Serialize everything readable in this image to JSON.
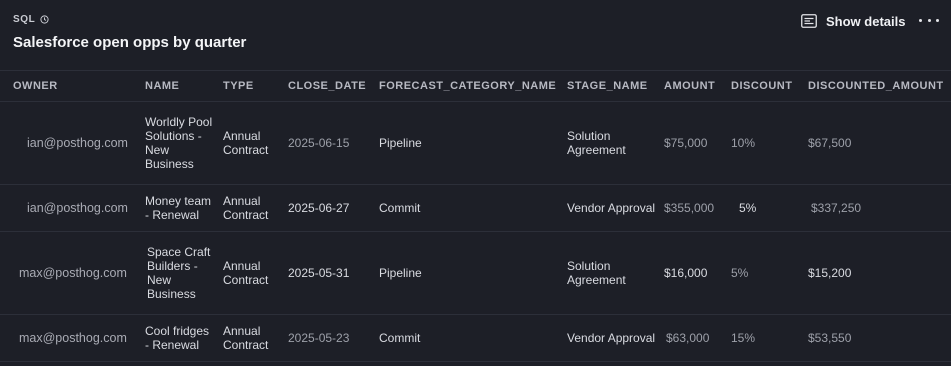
{
  "header": {
    "kind_label": "SQL",
    "title": "Salesforce open opps by quarter",
    "show_details_label": "Show details",
    "icons": {
      "kind": "clock-icon",
      "details": "details-panel-icon",
      "more": "more-dots-icon"
    }
  },
  "table": {
    "columns": [
      "OWNER",
      "NAME",
      "TYPE",
      "CLOSE_DATE",
      "FORECAST_CATEGORY_NAME",
      "STAGE_NAME",
      "AMOUNT",
      "DISCOUNT",
      "DISCOUNTED_AMOUNT"
    ],
    "rows": [
      {
        "owner": "ian@posthog.com",
        "name": "Worldly Pool Solutions - New Business",
        "type": "Annual Contract",
        "close_date": "2025-06-15",
        "forecast_category": "Pipeline",
        "stage": "Solution Agreement",
        "amount": "$75,000",
        "discount": "10%",
        "discounted_amount": "$67,500"
      },
      {
        "owner": "ian@posthog.com",
        "name": "Money team - Renewal",
        "type": "Annual Contract",
        "close_date": "2025-06-27",
        "forecast_category": "Commit",
        "stage": "Vendor Approval",
        "amount": "$355,000",
        "discount": "5%",
        "discounted_amount": "$337,250"
      },
      {
        "owner": "max@posthog.com",
        "name": "Space Craft Builders - New Business",
        "type": "Annual Contract",
        "close_date": "2025-05-31",
        "forecast_category": "Pipeline",
        "stage": "Solution Agreement",
        "amount": "$16,000",
        "discount": "5%",
        "discounted_amount": "$15,200"
      },
      {
        "owner": "max@posthog.com",
        "name": "Cool fridges - Renewal",
        "type": "Annual Contract",
        "close_date": "2025-05-23",
        "forecast_category": "Commit",
        "stage": "Vendor Approval",
        "amount": "$63,000",
        "discount": "15%",
        "discounted_amount": "$53,550"
      }
    ]
  },
  "colors": {
    "background": "#1d1f27",
    "border": "#2c2f39",
    "header_text": "#b7b9c2",
    "muted_text": "#a9abb4"
  }
}
